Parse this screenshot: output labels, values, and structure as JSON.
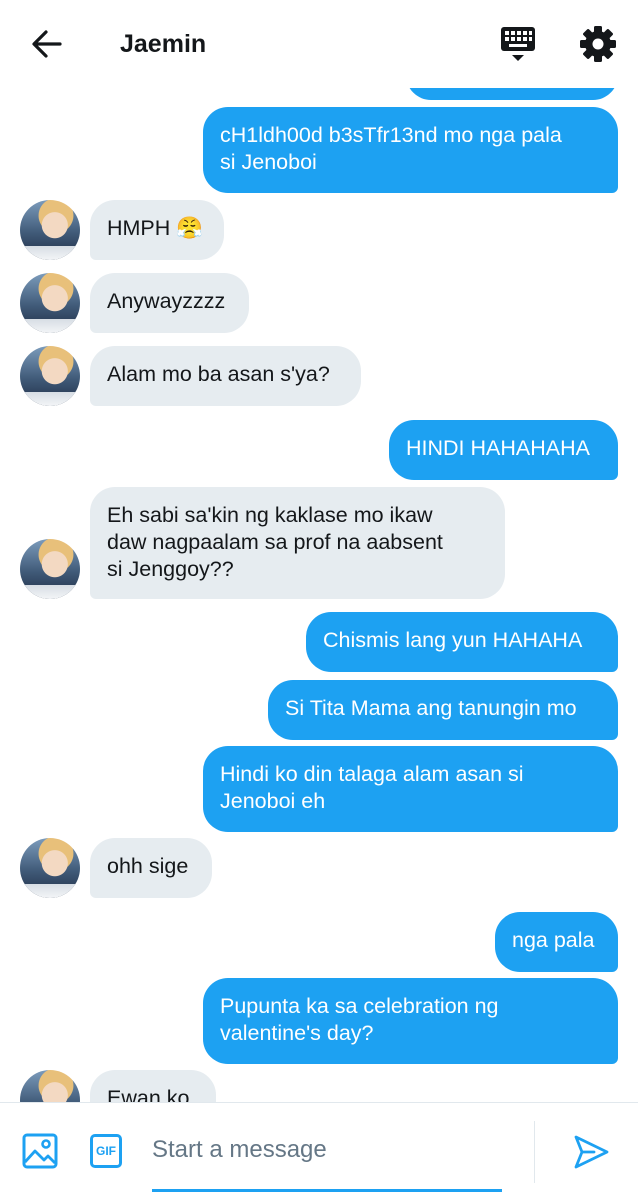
{
  "header": {
    "title": "Jaemin",
    "back_icon": "arrow-left-icon",
    "keyboard_icon": "keyboard-icon",
    "settings_icon": "gear-icon"
  },
  "messages": [
    {
      "from": "me",
      "text": "cH1ldh00d b3sTfr13nd mo nga pala\nsi Jenoboi"
    },
    {
      "from": "them",
      "text": "HMPH 😤"
    },
    {
      "from": "them",
      "text": "Anywayzzzz"
    },
    {
      "from": "them",
      "text": "Alam mo ba asan s'ya?"
    },
    {
      "from": "me",
      "text": "HINDI HAHAHAHA"
    },
    {
      "from": "them",
      "text": "Eh sabi sa'kin ng kaklase mo ikaw\ndaw nagpaalam sa prof na aabsent\nsi Jenggoy??"
    },
    {
      "from": "me",
      "text": "Chismis lang yun HAHAHA"
    },
    {
      "from": "me",
      "text": "Si Tita Mama ang tanungin mo"
    },
    {
      "from": "me",
      "text": "Hindi ko din talaga alam asan si\nJenoboi eh"
    },
    {
      "from": "them",
      "text": "ohh sige"
    },
    {
      "from": "me",
      "text": "nga pala"
    },
    {
      "from": "me",
      "text": "Pupunta ka sa celebration ng\nvalentine's day?"
    },
    {
      "from": "them",
      "text": "Ewan ko"
    }
  ],
  "composer": {
    "placeholder": "Start a message",
    "gif_label": "GIF",
    "image_icon": "image-icon",
    "send_icon": "send-icon"
  },
  "colors": {
    "accent": "#1da1f2",
    "received_bubble": "#e6ecf0",
    "text": "#14171a",
    "placeholder": "#657786"
  }
}
